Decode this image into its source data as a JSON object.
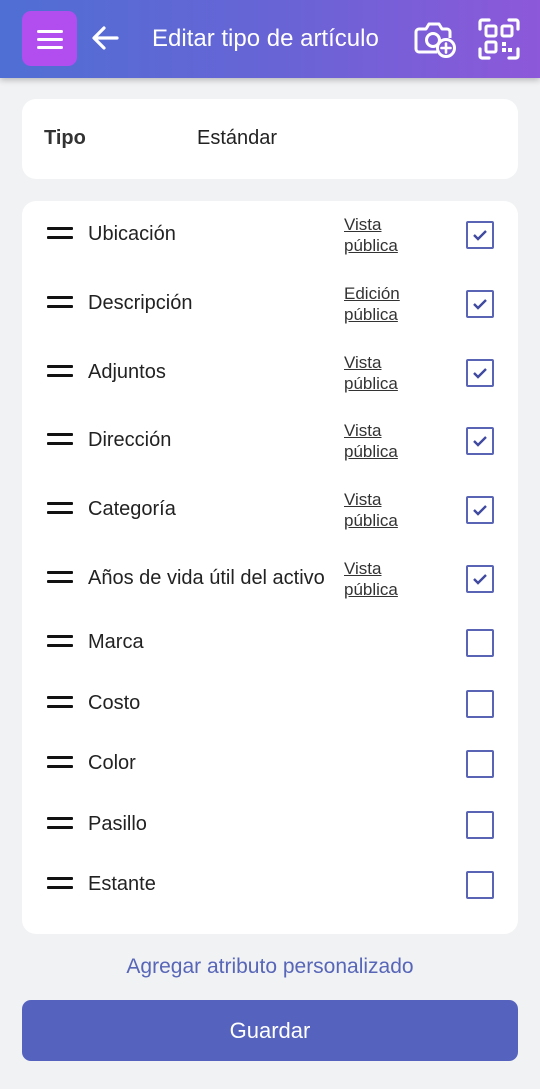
{
  "header": {
    "title": "Editar tipo de artículo",
    "icons": [
      "menu-icon",
      "back-arrow-icon",
      "add-photo-icon",
      "qr-scan-icon"
    ]
  },
  "type_card": {
    "label": "Tipo",
    "value": "Estándar"
  },
  "attributes": [
    {
      "label": "Ubicación",
      "visibility": "Vista pública",
      "checked": true
    },
    {
      "label": "Descripción",
      "visibility": "Edición pública",
      "checked": true
    },
    {
      "label": "Adjuntos",
      "visibility": "Vista pública",
      "checked": true
    },
    {
      "label": "Dirección",
      "visibility": "Vista pública",
      "checked": true
    },
    {
      "label": "Categoría",
      "visibility": "Vista pública",
      "checked": true
    },
    {
      "label": "Años de vida útil del activo",
      "visibility": "Vista pública",
      "checked": true
    },
    {
      "label": "Marca",
      "visibility": "",
      "checked": false
    },
    {
      "label": "Costo",
      "visibility": "",
      "checked": false
    },
    {
      "label": "Color",
      "visibility": "",
      "checked": false
    },
    {
      "label": "Pasillo",
      "visibility": "",
      "checked": false
    },
    {
      "label": "Estante",
      "visibility": "",
      "checked": false
    }
  ],
  "actions": {
    "add_custom": "Agregar atributo personalizado",
    "save": "Guardar"
  },
  "colors": {
    "header_gradient_start": "#4f6fd4",
    "header_gradient_end": "#8d58da",
    "menu_button": "#b24df0",
    "checkbox": "#5a64b4",
    "primary_button": "#5563bf",
    "link": "#5866b8"
  }
}
